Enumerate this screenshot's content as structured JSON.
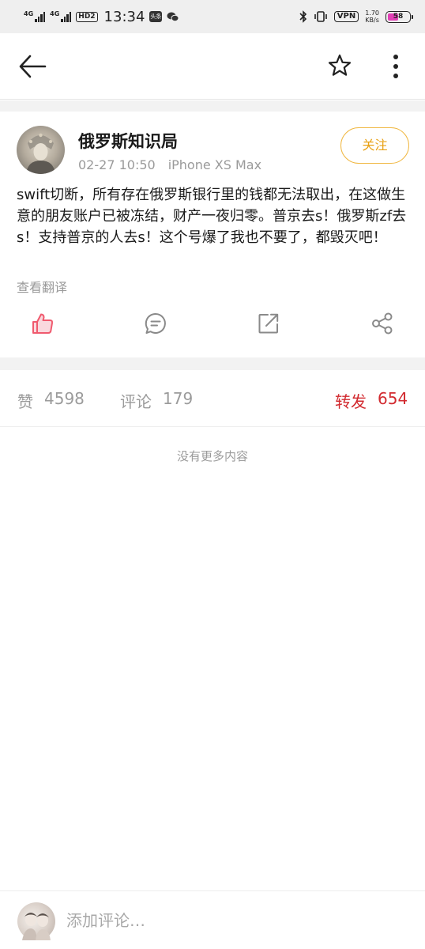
{
  "status_bar": {
    "signal1_label": "4G",
    "signal2_label": "4G",
    "hd_label": "HD2",
    "time": "13:34",
    "app_icon_label": "头条",
    "vpn_label": "VPN",
    "speed_value": "1.70",
    "speed_unit": "KB/s",
    "battery": "58",
    "battery_level": 0.58,
    "battery_color": "#e13fb5"
  },
  "nav": {
    "back_icon": "back-arrow-icon",
    "star_icon": "star-outline-icon",
    "more_icon": "more-vertical-icon"
  },
  "post": {
    "author": "俄罗斯知识局",
    "date": "02-27 10:50",
    "device": "iPhone XS Max",
    "follow_label": "关注",
    "text": "swift切断，所有存在俄罗斯银行里的钱都无法取出，在这做生意的朋友账户已被冻结，财产一夜归零。普京去s！俄罗斯zf去s！支持普京的人去s！这个号爆了我也不要了，都毁灭吧！",
    "translate_label": "查看翻译",
    "actions": [
      "like-icon",
      "comment-icon",
      "repost-icon",
      "share-icon"
    ]
  },
  "stats": {
    "likes_label": "赞",
    "likes_count": "4598",
    "comments_label": "评论",
    "comments_count": "179",
    "reposts_label": "转发",
    "reposts_count": "654"
  },
  "no_more": "没有更多内容",
  "comment_bar": {
    "placeholder": "添加评论…"
  },
  "colors": {
    "accent_red": "#d22a2f",
    "follow_gold": "#e8a012",
    "like_pink": "#f05a6e"
  }
}
